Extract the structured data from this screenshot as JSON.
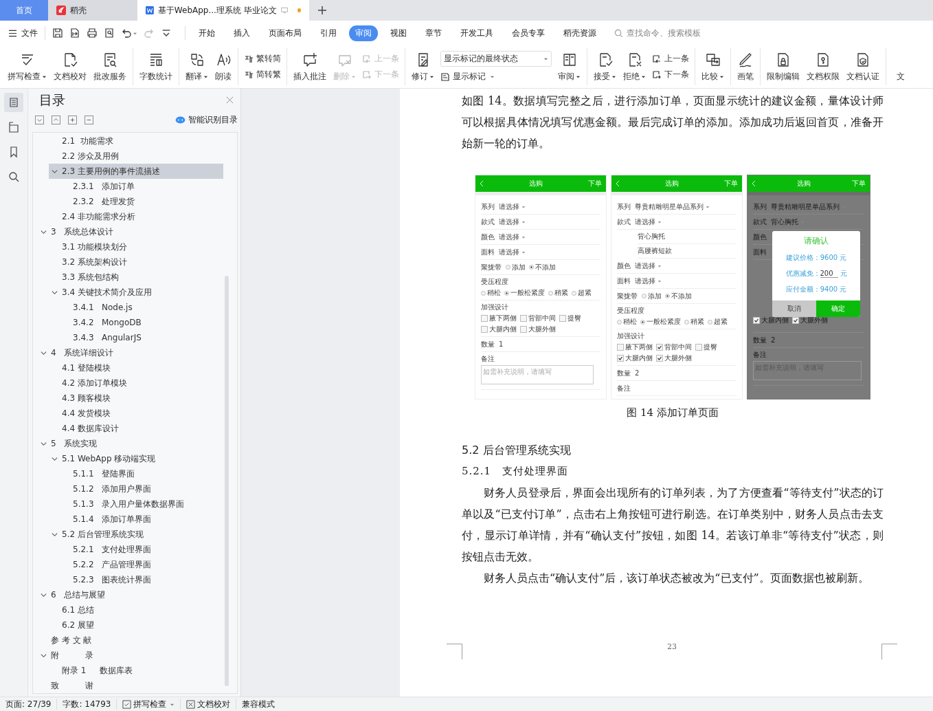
{
  "tabbar": {
    "tabs": [
      {
        "kind": "home",
        "label": "首页",
        "selected": false
      },
      {
        "kind": "docer",
        "label": "稻壳",
        "selected": false
      },
      {
        "kind": "doc",
        "label": "基于WebApp...理系统 毕业论文",
        "selected": true,
        "modified": true
      }
    ]
  },
  "menu": {
    "file": "文件",
    "tabs": [
      {
        "label": "开始",
        "selected": false
      },
      {
        "label": "插入",
        "selected": false
      },
      {
        "label": "页面布局",
        "selected": false
      },
      {
        "label": "引用",
        "selected": false
      },
      {
        "label": "审阅",
        "selected": true
      },
      {
        "label": "视图",
        "selected": false
      },
      {
        "label": "章节",
        "selected": false
      },
      {
        "label": "开发工具",
        "selected": false
      },
      {
        "label": "会员专享",
        "selected": false
      },
      {
        "label": "稻壳资源",
        "selected": false
      }
    ],
    "search": {
      "placeholder": "查找命令、搜索模板"
    }
  },
  "ribbon": {
    "groups": [
      {
        "items": [
          {
            "kind": "big",
            "label": "拼写检查",
            "menu": true,
            "disabled": false
          },
          {
            "kind": "big",
            "label": "文档校对",
            "menu": false,
            "disabled": false
          },
          {
            "kind": "big",
            "label": "批改服务",
            "menu": false,
            "disabled": false
          }
        ]
      },
      {
        "items": [
          {
            "kind": "big",
            "label": "字数统计",
            "menu": false,
            "disabled": false
          }
        ]
      },
      {
        "items": [
          {
            "kind": "big",
            "label": "翻译",
            "menu": true,
            "disabled": false
          },
          {
            "kind": "big",
            "label": "朗读",
            "menu": false,
            "disabled": false
          }
        ]
      },
      {
        "items": [
          {
            "kind": "stack",
            "entries": [
              {
                "label": "繁转简",
                "disabled": false
              },
              {
                "label": "简转繁",
                "disabled": false
              }
            ]
          }
        ]
      },
      {
        "items": [
          {
            "kind": "big",
            "label": "插入批注",
            "menu": false,
            "disabled": false
          },
          {
            "kind": "big",
            "label": "删除",
            "menu": true,
            "disabled": true
          },
          {
            "kind": "stack",
            "entries": [
              {
                "label": "上一条",
                "disabled": true
              },
              {
                "label": "下一条",
                "disabled": true
              }
            ]
          }
        ]
      },
      {
        "items": [
          {
            "kind": "big",
            "label": "修订",
            "menu": true,
            "disabled": false
          },
          {
            "kind": "select",
            "value": "显示标记的最终状态",
            "button": {
              "label": "显示标记",
              "menu": true
            }
          },
          {
            "kind": "big",
            "label": "审阅",
            "menu": true,
            "disabled": false
          }
        ]
      },
      {
        "items": [
          {
            "kind": "big",
            "label": "接受",
            "menu": true,
            "disabled": false
          },
          {
            "kind": "big",
            "label": "拒绝",
            "menu": true,
            "disabled": false
          },
          {
            "kind": "stack",
            "entries": [
              {
                "label": "上一条",
                "disabled": false
              },
              {
                "label": "下一条",
                "disabled": false
              }
            ]
          }
        ]
      },
      {
        "items": [
          {
            "kind": "big",
            "label": "比较",
            "menu": true,
            "disabled": false
          }
        ]
      },
      {
        "items": [
          {
            "kind": "big",
            "label": "画笔",
            "menu": false,
            "disabled": false
          }
        ]
      },
      {
        "items": [
          {
            "kind": "big",
            "label": "限制编辑",
            "menu": false,
            "disabled": false
          },
          {
            "kind": "big",
            "label": "文档权限",
            "menu": false,
            "disabled": false
          },
          {
            "kind": "big",
            "label": "文档认证",
            "menu": false,
            "disabled": false
          }
        ]
      },
      {
        "items": [
          {
            "kind": "big",
            "label": "文",
            "menu": false,
            "disabled": false
          }
        ]
      }
    ]
  },
  "toc": {
    "title": "目录",
    "smart": "智能识别目录",
    "items": [
      {
        "children": [
          {
            "label": "2.1  功能需求",
            "selected": false
          },
          {
            "label": "2.2 涉众及用例",
            "selected": false
          },
          {
            "label": "2.3 主要用例的事件流描述",
            "selected": true,
            "expanded": true,
            "children": [
              {
                "label": "2.3.1   添加订单",
                "selected": false
              },
              {
                "label": "2.3.2   处理发货",
                "selected": false
              }
            ]
          },
          {
            "label": "2.4 非功能需求分析",
            "selected": false
          }
        ]
      },
      {
        "label": "3   系统总体设计",
        "selected": false,
        "expanded": true,
        "children": [
          {
            "label": "3.1 功能模块划分",
            "selected": false
          },
          {
            "label": "3.2 系统架构设计",
            "selected": false
          },
          {
            "label": "3.3 系统包结构",
            "selected": false
          },
          {
            "label": "3.4 关键技术简介及应用",
            "selected": false,
            "expanded": true,
            "children": [
              {
                "label": "3.4.1   Node.js",
                "selected": false
              },
              {
                "label": "3.4.2   MongoDB",
                "selected": false
              },
              {
                "label": "3.4.3   AngularJS",
                "selected": false
              }
            ]
          }
        ]
      },
      {
        "label": "4   系统详细设计",
        "selected": false,
        "expanded": true,
        "children": [
          {
            "label": "4.1 登陆模块",
            "selected": false
          },
          {
            "label": "4.2 添加订单模块",
            "selected": false
          },
          {
            "label": "4.3 顾客模块",
            "selected": false
          },
          {
            "label": "4.4 发货模块",
            "selected": false
          },
          {
            "label": "4.4 数据库设计",
            "selected": false
          }
        ]
      },
      {
        "label": "5   系统实现",
        "selected": false,
        "expanded": true,
        "children": [
          {
            "label": "5.1 WebApp 移动端实现",
            "selected": false,
            "expanded": true,
            "children": [
              {
                "label": "5.1.1   登陆界面",
                "selected": false
              },
              {
                "label": "5.1.2   添加用户界面",
                "selected": false
              },
              {
                "label": "5.1.3   录入用户量体数据界面",
                "selected": false
              },
              {
                "label": "5.1.4   添加订单界面",
                "selected": false
              }
            ]
          },
          {
            "label": "5.2 后台管理系统实现",
            "selected": false,
            "expanded": true,
            "children": [
              {
                "label": "5.2.1   支付处理界面",
                "selected": false
              },
              {
                "label": "5.2.2   产品管理界面",
                "selected": false
              },
              {
                "label": "5.2.3   图表统计界面",
                "selected": false
              }
            ]
          }
        ]
      },
      {
        "label": "6   总结与展望",
        "selected": false,
        "expanded": true,
        "children": [
          {
            "label": "6.1 总结",
            "selected": false
          },
          {
            "label": "6.2 展望",
            "selected": false
          }
        ]
      },
      {
        "label": "参 考 文 献",
        "selected": false
      },
      {
        "label": "附          录",
        "selected": false,
        "expanded": true,
        "children": [
          {
            "label": "附录 1     数据库表",
            "selected": false
          }
        ]
      },
      {
        "label": "致          谢",
        "selected": false
      }
    ]
  },
  "document": {
    "blocks": [
      {
        "kind": "para",
        "indent": false,
        "text": "如图 14。数据填写完整之后，进行添加订单，页面显示统计的建议金额，量体设计师可以根据具体情况填写优惠金额。最后完成订单的添加。添加成功后返回首页，准备开始新一轮的订单。"
      },
      {
        "kind": "figure",
        "caption": "图 14  添加订单页面",
        "phones": [
          {
            "title": "选购",
            "action": "下单",
            "dimmed": false,
            "rows": [
              {
                "kind": "select",
                "label": "系列",
                "value": "请选择"
              },
              {
                "kind": "select",
                "label": "款式",
                "value": "请选择"
              },
              {
                "kind": "select",
                "label": "颜色",
                "value": "请选择"
              },
              {
                "kind": "select",
                "label": "面料",
                "value": "请选择"
              },
              {
                "kind": "radio",
                "label": "聚拢带",
                "options": [
                  {
                    "label": "添加",
                    "selected": false
                  },
                  {
                    "label": "不添加",
                    "selected": true
                  }
                ]
              },
              {
                "kind": "radiogroup",
                "label": "受压程度",
                "options": [
                  {
                    "label": "稍松",
                    "selected": false
                  },
                  {
                    "label": "一般松紧度",
                    "selected": true
                  },
                  {
                    "label": "稍紧",
                    "selected": false
                  },
                  {
                    "label": "超紧",
                    "selected": false
                  }
                ]
              },
              {
                "kind": "checks",
                "label": "加强设计",
                "options": [
                  {
                    "label": "腋下两侧",
                    "checked": false
                  },
                  {
                    "label": "背部中间",
                    "checked": false
                  },
                  {
                    "label": "提臀",
                    "checked": false
                  },
                  {
                    "label": "大腿内侧",
                    "checked": false
                  },
                  {
                    "label": "大腿外侧",
                    "checked": false
                  }
                ]
              },
              {
                "kind": "value",
                "label": "数量",
                "value": "1"
              },
              {
                "kind": "note",
                "label": "备注",
                "placeholder": "如需补充说明，请填写"
              }
            ]
          },
          {
            "title": "选购",
            "action": "下单",
            "dimmed": false,
            "rows": [
              {
                "kind": "select",
                "label": "系列",
                "value": "尊贵精雕明星单品系列"
              },
              {
                "kind": "select",
                "label": "款式",
                "value": "请选择"
              },
              {
                "kind": "options",
                "items": [
                  "背心胸托",
                  "高腰裤短款"
                ]
              },
              {
                "kind": "select",
                "label": "颜色",
                "value": "请选择"
              },
              {
                "kind": "select",
                "label": "面料",
                "value": "请选择"
              },
              {
                "kind": "radio",
                "label": "聚拢带",
                "options": [
                  {
                    "label": "添加",
                    "selected": false
                  },
                  {
                    "label": "不添加",
                    "selected": true
                  }
                ]
              },
              {
                "kind": "radiogroup",
                "label": "受压程度",
                "options": [
                  {
                    "label": "稍松",
                    "selected": false
                  },
                  {
                    "label": "一般松紧度",
                    "selected": true
                  },
                  {
                    "label": "稍紧",
                    "selected": false
                  },
                  {
                    "label": "超紧",
                    "selected": false
                  }
                ]
              },
              {
                "kind": "checks",
                "label": "加强设计",
                "options": [
                  {
                    "label": "腋下两侧",
                    "checked": false
                  },
                  {
                    "label": "背部中间",
                    "checked": true
                  },
                  {
                    "label": "提臀",
                    "checked": false
                  },
                  {
                    "label": "大腿内侧",
                    "checked": true
                  },
                  {
                    "label": "大腿外侧",
                    "checked": true
                  }
                ]
              },
              {
                "kind": "value",
                "label": "数量",
                "value": "2"
              },
              {
                "kind": "label",
                "label": "备注"
              }
            ]
          },
          {
            "title": "选购",
            "action": "下单",
            "dimmed": true,
            "rows": [
              {
                "kind": "select",
                "label": "系列",
                "value": "尊贵精雕明星单品系列"
              },
              {
                "kind": "select",
                "label": "款式",
                "value": "背心胸托"
              },
              {
                "kind": "label",
                "label": "颜色"
              },
              {
                "kind": "label",
                "label": "面料"
              },
              {
                "kind": "checks",
                "options": [
                  {
                    "label": "大腿内侧",
                    "checked": true
                  },
                  {
                    "label": "大腿外侧",
                    "checked": true
                  }
                ]
              },
              {
                "kind": "value",
                "label": "数量",
                "value": "2"
              },
              {
                "kind": "note",
                "label": "备注",
                "placeholder": "如需补充说明，请填写"
              }
            ],
            "dialog": {
              "title": "请确认",
              "lines": [
                {
                  "kind": "text",
                  "text": "建议价格：9600 元"
                },
                {
                  "kind": "input",
                  "label": "优惠减免：",
                  "value": "200",
                  "unit": "元"
                },
                {
                  "kind": "text",
                  "text": "应付金额：9400 元"
                }
              ],
              "buttons": [
                {
                  "label": "取消",
                  "primary": false
                },
                {
                  "label": "确定",
                  "primary": true
                }
              ]
            }
          }
        ]
      },
      {
        "kind": "heading",
        "text": "5.2 后台管理系统实现"
      },
      {
        "kind": "subheading",
        "text": "5.2.1　支付处理界面"
      },
      {
        "kind": "para",
        "indent": true,
        "text": "财务人员登录后，界面会出现所有的订单列表，为了方便查看“等待支付”状态的订单以及“已支付订单”，点击右上角按钮可进行刷选。在订单类别中，财务人员点击去支付，显示订单详情，并有“确认支付”按钮，如图 14。若该订单非“等待支付”状态，则按钮点击无效。"
      },
      {
        "kind": "para",
        "indent": true,
        "text": "财务人员点击“确认支付”后，该订单状态被改为“已支付”。页面数据也被刷新。"
      }
    ],
    "page_number": "23"
  },
  "status": {
    "items": [
      {
        "kind": "text",
        "label": "页面: 27/39"
      },
      {
        "kind": "text",
        "label": "字数: 14793"
      },
      {
        "kind": "spell",
        "label": "拼写检查"
      },
      {
        "kind": "proof",
        "label": "文档校对"
      },
      {
        "kind": "text",
        "label": "兼容模式"
      }
    ]
  }
}
